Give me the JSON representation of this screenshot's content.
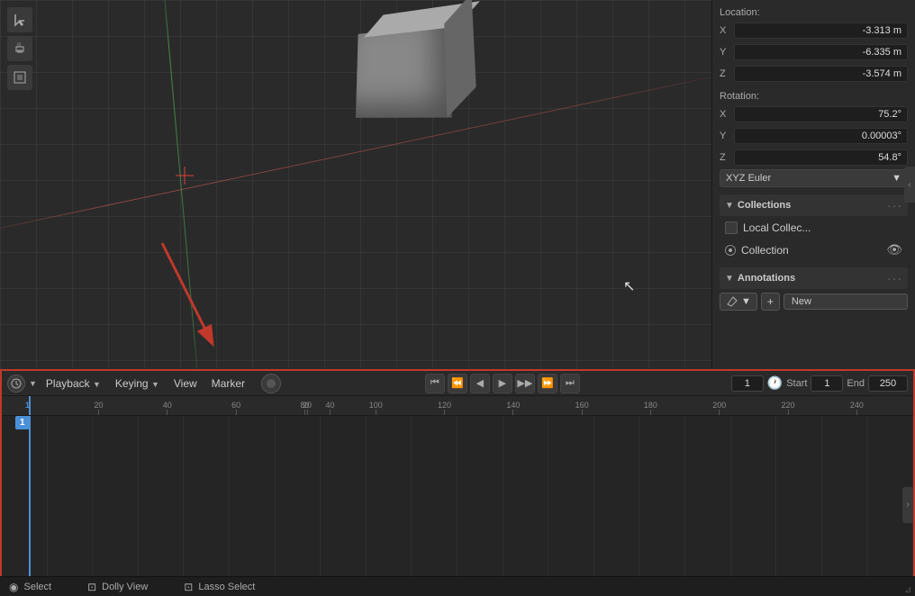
{
  "viewport": {
    "background": "#2a2a2a"
  },
  "properties": {
    "location_label": "Location:",
    "location_x": "-3.313 m",
    "location_y": "-6.335 m",
    "location_z": "-3.574 m",
    "rotation_label": "Rotation:",
    "rotation_x": "75.2°",
    "rotation_y": "0.00003°",
    "rotation_z": "54.8°",
    "rotation_mode": "XYZ Euler",
    "collections_label": "Collections",
    "local_collect_label": "Local Collec...",
    "collection_label": "Collection",
    "annotations_label": "Annotations",
    "new_label": "New"
  },
  "timeline": {
    "playback_label": "Playback",
    "keying_label": "Keying",
    "view_label": "View",
    "marker_label": "Marker",
    "current_frame": "1",
    "start_label": "Start",
    "start_frame": "1",
    "end_label": "End",
    "end_frame": "250",
    "ruler_marks": [
      20,
      40,
      60,
      80,
      100,
      120,
      140,
      160,
      180,
      200,
      220,
      240
    ]
  },
  "status_bar": {
    "select_label": "Select",
    "dolly_view_label": "Dolly View",
    "lasso_select_label": "Lasso Select"
  },
  "toolbar": {
    "icon1": "⊕",
    "icon2": "⊡",
    "icon3": "⊞"
  }
}
